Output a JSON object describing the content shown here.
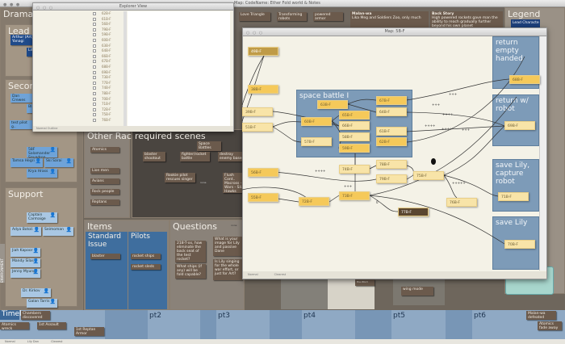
{
  "main_window": {
    "title": "Map: CodeName: Ether Fold world & Notes"
  },
  "left": {
    "dramatis": "Dramatis",
    "lead": {
      "title": "Lead",
      "people": [
        "Arthur (Art) Yanagi",
        "Lily"
      ]
    },
    "second": {
      "title": "Second",
      "people": [
        "Dan Crewes",
        "Bl..",
        "test pilot g..",
        "58F Salamander Squadron",
        "Tamsa Hegri",
        "Ski Sarai",
        "Krya Hrass"
      ]
    },
    "support": {
      "title": "Support",
      "people": [
        "Captain Carmaige",
        "Adya Botoli",
        "Seimoman",
        "Jiah Kapoor",
        "Mandy Silas",
        "Jenny Myung",
        "Dr. Kirkov",
        "Galan Tarris"
      ]
    },
    "side_tab": "ENVIRONMENT"
  },
  "other_races": {
    "title": "Other Races",
    "items": [
      "Atomics",
      "Lion men",
      "Avians",
      "Rock people",
      "Reptans"
    ]
  },
  "required_scenes": {
    "title": "required scenes",
    "items": [
      "Space Battles",
      "blaster shootout",
      "fighter/rocket battle",
      "destroy enemy base",
      "Rookie pilot rescues singer",
      "Flush Cont.. Macross - Wars - Sil.. Hawks"
    ],
    "note": "none"
  },
  "items": {
    "title": "Items",
    "standard": {
      "title": "Standard Issue",
      "items": [
        "blaster"
      ]
    },
    "pilots": {
      "title": "Pilots",
      "items": [
        "rocket ships",
        "rocket sleds"
      ]
    }
  },
  "questions": {
    "title": "Questions",
    "note": "none",
    "items": [
      "218-T-xx, how eliminate the back seat of the test rocket?",
      "What ships (if any) will be fold capable?",
      "What is your image for Lily and passive Dane",
      "Is Lily singing for the whole war effort, or just for Art?"
    ]
  },
  "top_notes": [
    "Love Triangle",
    "Transforming robots",
    "powered armor"
  ],
  "malan": {
    "title": "Malan-wa",
    "text": "Lika Meg and Soldiers Zoo, only much"
  },
  "back_story": {
    "title": "Back Story",
    "text": "High powered rockets gave man the ability to reach gradually further beyond his own planet"
  },
  "legend": {
    "title": "Legend",
    "item": "Lead Characte"
  },
  "explorer": {
    "title": "Explorer View",
    "list": [
      "62B-F",
      "61B-F",
      "56B-F",
      "79B-F",
      "59B-F",
      "60B-F",
      "63B-F",
      "64B-F",
      "66B-F",
      "67B-F",
      "68B-F",
      "69B-F",
      "73B-F",
      "77B-F",
      "74B-F",
      "78B-F",
      "70B-F",
      "71B-F",
      "72B-F",
      "75B-F",
      "76B-F"
    ],
    "footer": "Normal  Outline"
  },
  "map_window": {
    "title": "Map: 5B-F",
    "status": "Normal",
    "zoom": "Clearest",
    "groups": [
      "space battle I",
      "return empty handed",
      "return w/ robot",
      "save Lily, capture robot",
      "save Lily"
    ],
    "nodes": [
      "49B-F",
      "38B-F",
      "39B-F",
      "51B-F",
      "63B-F",
      "67B-F",
      "64B-F",
      "60B-F",
      "65B-F",
      "66B-F",
      "61B-F",
      "57B-F",
      "58B-F",
      "59B-F",
      "62B-F",
      "68B-F",
      "69B-F",
      "71B-F",
      "70B-F",
      "56B-F",
      "74B-F",
      "78B-F",
      "79B-F",
      "75B-F",
      "73B-F",
      "72B-F",
      "55B-F",
      "76B-F",
      "77B-F"
    ],
    "edge_labels": [
      "+++",
      "+++",
      "++++",
      "++++",
      "+++",
      "++++",
      "+++",
      "+++++",
      "++++",
      "0"
    ]
  },
  "behind_notes": [
    "the Word",
    "wing mode"
  ],
  "timeline": {
    "title": "Timel",
    "parts": [
      "pt2",
      "pt3",
      "pt4",
      "pt5",
      "pt6"
    ],
    "notes": [
      "Chambers discovered",
      "Atomics wreck",
      "1st Assault",
      "1st Reptan Armor",
      "Malan-wa defeated",
      "Atomics fade away"
    ]
  },
  "status_bar": {
    "mode": "Normal",
    "field": "Lily Dan",
    "zoom": "Clearest"
  }
}
